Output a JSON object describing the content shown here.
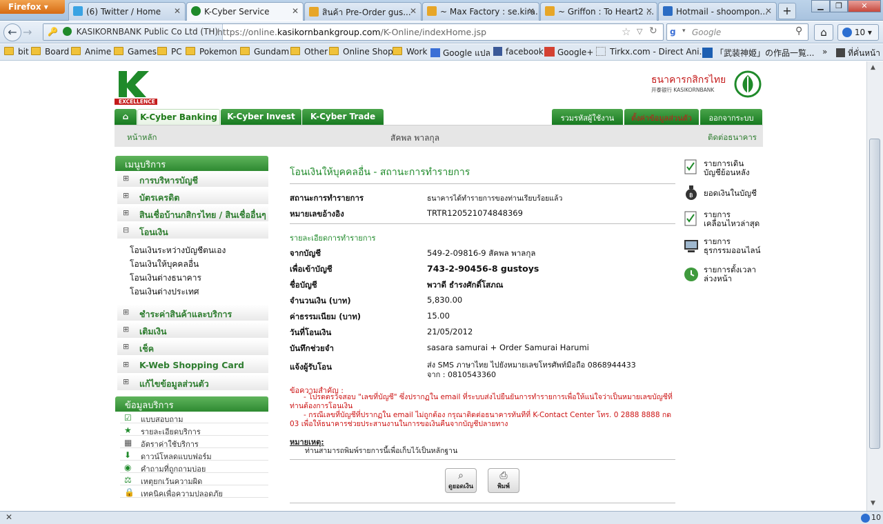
{
  "browser": {
    "app_button": "Firefox",
    "tabs": [
      {
        "label": "(6) Twitter / Home",
        "icon": "twitter-icon"
      },
      {
        "label": "K-Cyber Service",
        "icon": "kbank-icon"
      },
      {
        "label": "สินค้า Pre-Order gus...",
        "icon": "page-icon"
      },
      {
        "label": "~ Max Factory : se.kira...",
        "icon": "page-icon"
      },
      {
        "label": "~ Griffon : To Heart2 ...",
        "icon": "page-icon"
      },
      {
        "label": "Hotmail - shoompon...",
        "icon": "hotmail-icon"
      }
    ],
    "new_tab": "+",
    "site_identity": "KASIKORNBANK Public Co Ltd (TH)",
    "url_prefix": "https://online.",
    "url_domain": "kasikornbankgroup.com",
    "url_path": "/K-Online/indexHome.jsp",
    "search_placeholder": "Google",
    "notification_count": "10",
    "bookmarks": [
      "bit",
      "Board",
      "Anime",
      "Games",
      "PC",
      "Pokemon",
      "Gundam",
      "Other",
      "Online Shop",
      "Work",
      "Google แปล",
      "facebook",
      "Google+",
      "Tirkx.com - Direct Ani...",
      "「武装神姫」の作品一覧...",
      "ที่คั่นหน้า"
    ],
    "bookmarks_more": "»",
    "status_count": "10"
  },
  "bank": {
    "brand_excellence": "EXCELLENCE",
    "bank_name_th": "ธนาคารกสิกรไทย",
    "bank_name_en": "开泰银行 KASIKORNBANK",
    "main_tabs": [
      "K-Cyber Banking",
      "K-Cyber Invest",
      "K-Cyber Trade"
    ],
    "top_links": [
      "รวมรหัสผู้ใช้งาน",
      "ตั้งค่าข้อมูลส่วนตัว",
      "ออกจากระบบ"
    ],
    "home_link": "หน้าหลัก",
    "user_name": "สัคพล พาลกุล",
    "contact_link": "ติดต่อธนาคาร"
  },
  "menu": {
    "header": "เมนูบริการ",
    "items": [
      {
        "label": "การบริหารบัญชี",
        "sign": "⊞"
      },
      {
        "label": "บัตรเครดิต",
        "sign": "⊞"
      },
      {
        "label": "สินเชื่อบ้านกสิกรไทย / สินเชื่ออื่นๆ",
        "sign": "⊞"
      },
      {
        "label": "โอนเงิน",
        "sign": "⊟"
      },
      {
        "label": "ชำระค่าสินค้าและบริการ",
        "sign": "⊞"
      },
      {
        "label": "เติมเงิน",
        "sign": "⊞"
      },
      {
        "label": "เช็ค",
        "sign": "⊞"
      },
      {
        "label": "K-Web Shopping Card",
        "sign": "⊞"
      },
      {
        "label": "แก้ไขข้อมูลส่วนตัว",
        "sign": "⊞"
      }
    ],
    "transfer_sub": [
      "โอนเงินระหว่างบัญชีตนเอง",
      "โอนเงินให้บุคคลอื่น",
      "โอนเงินต่างธนาคาร",
      "โอนเงินต่างประเทศ"
    ]
  },
  "service_info": {
    "header": "ข้อมูลบริการ",
    "items": [
      "แบบสอบถาม",
      "รายละเอียดบริการ",
      "อัตราค่าใช้บริการ",
      "ดาวน์โหลดแบบฟอร์ม",
      "คำถามที่ถูกถามบ่อย",
      "เหตุยกเว้นความผิด",
      "เทคนิคเพื่อความปลอดภัย"
    ]
  },
  "content": {
    "title": "โอนเงินให้บุคคลอื่น - สถานะการทำรายการ",
    "status_label": "สถานะการทำรายการ",
    "status_value": "ธนาคารได้ทำรายการของท่านเรียบร้อยแล้ว",
    "ref_label": "หมายเลขอ้างอิง",
    "ref_value": "TRTR120521074848369",
    "details_header": "รายละเอียดการทำรายการ",
    "from_label": "จากบัญชี",
    "from_value": "549-2-09816-9 สัคพล พาลกุล",
    "to_label": "เพื่อเข้าบัญชี",
    "to_value": "743-2-90456-8 gustoys",
    "name_label": "ชื่อบัญชี",
    "name_value": "พวาดี ธำรงศักดิ์โสภณ",
    "amount_label": "จำนวนเงิน (บาท)",
    "amount_value": "5,830.00",
    "fee_label": "ค่าธรรมเนียม (บาท)",
    "fee_value": "15.00",
    "date_label": "วันที่โอนเงิน",
    "date_value": "21/05/2012",
    "memo_label": "บันทึกช่วยจำ",
    "memo_value": "sasara samurai + Order Samurai Harumi",
    "notify_label": "แจ้งผู้รับโอน",
    "notify_line1": "ส่ง SMS ภาษาไทย ไปยังหมายเลขโทรศัพท์มือถือ 0868944433",
    "notify_line2": "จาก : 0810543360",
    "important_header": "ข้อความสำคัญ :",
    "important_1": "- โปรดตรวจสอบ \"เลขที่บัญชี\" ซึ่งปรากฏใน email ที่ระบบส่งไปยืนยันการทำรายการเพื่อให้แน่ใจว่าเป็นหมายเลขบัญชีที่ท่านต้องการโอนเงิน",
    "important_2": "- กรณีเลขที่บัญชีที่ปรากฏใน email ไม่ถูกต้อง กรุณาติดต่อธนาคารทันทีที่ K-Contact Center โทร. 0 2888 8888 กด 03 เพื่อให้ธนาคารช่วยประสานงานในการขอเงินคืนจากบัญชีปลายทาง",
    "note_header": "หมายเหตุ:",
    "note_text": "ท่านสามารถพิมพ์รายการนี้เพื่อเก็บไว้เป็นหลักฐาน",
    "btn_view_balance": "ดูยอดเงิน",
    "btn_print": "พิมพ์"
  },
  "right_links": [
    {
      "line1": "รายการเดิน",
      "line2": "บัญชีย้อนหลัง",
      "icon": "statement-check-icon"
    },
    {
      "line1": "ยอดเงินในบัญชี",
      "line2": "",
      "icon": "money-bag-icon"
    },
    {
      "line1": "รายการ",
      "line2": "เคลื่อนไหวล่าสุด",
      "icon": "recent-check-icon"
    },
    {
      "line1": "รายการ",
      "line2": "ธุรกรรมออนไลน์",
      "icon": "online-transaction-icon"
    },
    {
      "line1": "รายการตั้งเวลา",
      "line2": "ล่วงหน้า",
      "icon": "clock-icon"
    }
  ],
  "colors": {
    "bank_green": "#1f8a2a",
    "alert_red": "#cc1111",
    "orange_link": "#e25b10"
  }
}
